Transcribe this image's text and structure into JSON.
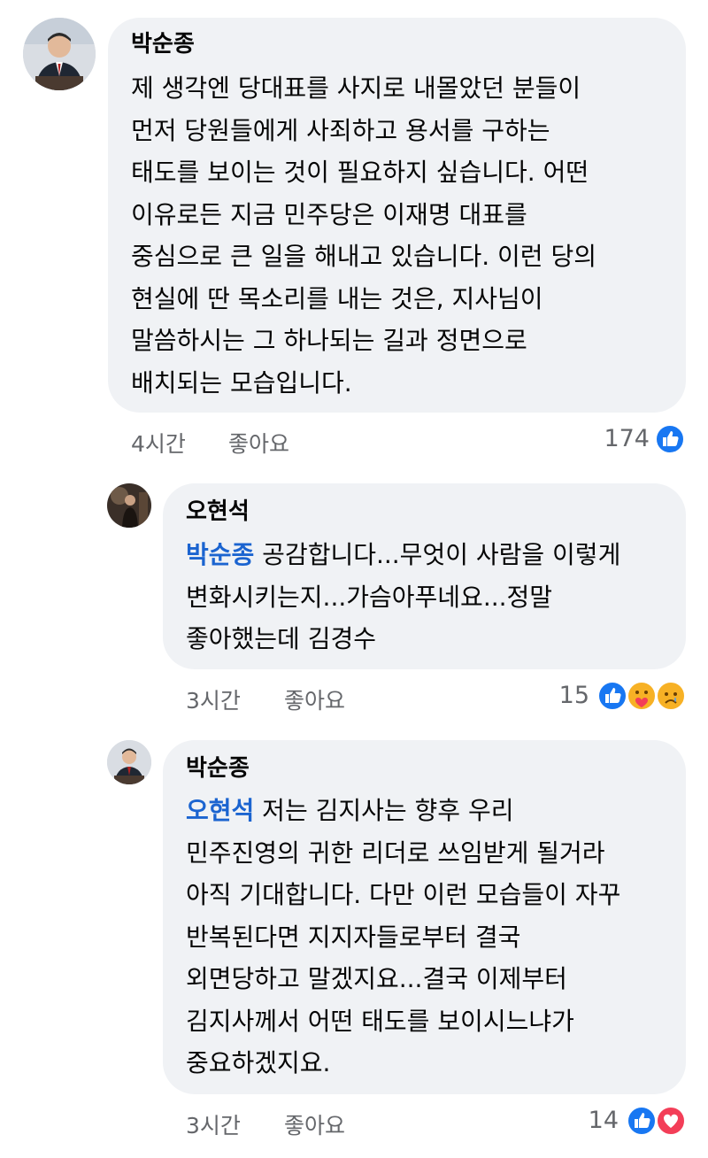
{
  "comments": [
    {
      "author": "박순종",
      "lines": [
        "제 생각엔 당대표를 사지로 내몰았던 분들이",
        "먼저 당원들에게 사죄하고 용서를 구하는",
        "태도를 보이는 것이 필요하지 싶습니다. 어떤",
        "이유로든 지금 민주당은 이재명 대표를",
        "중심으로 큰 일을 해내고 있습니다. 이런 당의",
        "현실에 딴 목소리를 내는 것은, 지사님이",
        "말씀하시는 그 하나되는 길과 정면으로",
        "배치되는 모습입니다."
      ],
      "time": "4시간",
      "like_label": "좋아요",
      "reaction_count": "174",
      "reactions": [
        "like-icon"
      ]
    },
    {
      "author": "오현석",
      "mention": "박순종",
      "first_line_rest": " 공감합니다...무엇이 사람을 이렇게",
      "lines": [
        "변화시키는지...가슴아푸네요...정말",
        "좋아했는데 김경수"
      ],
      "time": "3시간",
      "like_label": "좋아요",
      "reaction_count": "15",
      "reactions": [
        "like-icon",
        "care-icon",
        "sad-icon"
      ]
    },
    {
      "author": "박순종",
      "mention": "오현석",
      "first_line_rest": " 저는 김지사는 향후 우리",
      "lines": [
        "민주진영의 귀한 리더로 쓰임받게 될거라",
        "아직 기대합니다. 다만 이런 모습들이 자꾸",
        "반복된다면 지지자들로부터 결국",
        "외면당하고 말겠지요...결국 이제부터",
        "김지사께서 어떤 태도를 보이시느냐가",
        "중요하겠지요."
      ],
      "time": "3시간",
      "like_label": "좋아요",
      "reaction_count": "14",
      "reactions": [
        "like-icon",
        "love-icon"
      ]
    }
  ],
  "colors": {
    "bubble": "#f0f2f5",
    "mention": "#1b64d0",
    "meta": "#65676b",
    "like": "#1877f2",
    "love": "#f33e58"
  }
}
